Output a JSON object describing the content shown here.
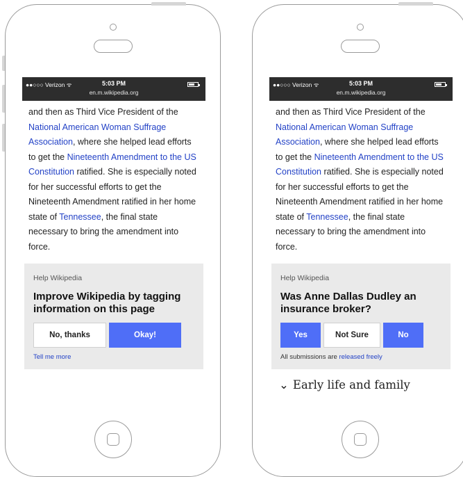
{
  "status_bar": {
    "carrier": "●●○○○ Verizon ᯤ",
    "time": "5:03 PM",
    "url": "en.m.wikipedia.org"
  },
  "article": {
    "p1_before": "and then as Third Vice President of the ",
    "link1": "National American Woman Suffrage Association",
    "p1_mid": ", where she helped lead efforts to get the ",
    "link2": "Nineteenth Amendment to the US Constitution",
    "p1_after": " ratified. She is especially noted for her successful efforts to get the Nineteenth Amendment ratified in her home state of ",
    "link3": "Tennessee",
    "p1_end": ", the final state necessary to bring the amendment into force."
  },
  "left_card": {
    "kicker": "Help Wikipedia",
    "title": "Improve Wikipedia by tagging information on this page",
    "no_button": "No, thanks",
    "ok_button": "Okay!",
    "tell_more": "Tell me more"
  },
  "right_card": {
    "kicker": "Help Wikipedia",
    "title": "Was Anne Dallas Dudley an insurance broker?",
    "yes_button": "Yes",
    "notsure_button": "Not Sure",
    "no_button": "No",
    "footer_prefix": "All submissions are ",
    "footer_link": "released freely"
  },
  "section": {
    "chevron": "⌄",
    "heading": "Early life and family"
  },
  "colors": {
    "accent_blue": "#4f6ef7",
    "link_blue": "#2342c6",
    "status_bar": "#2d2d2d",
    "card_bg": "#eaeaea"
  }
}
